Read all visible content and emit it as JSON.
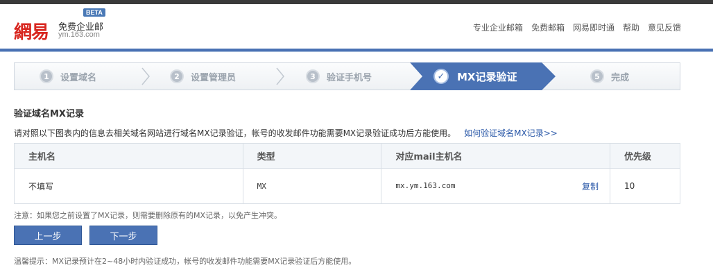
{
  "brand": {
    "logo": "網易",
    "title": "免费企业邮",
    "domain": "ym.163.com",
    "badge": "BETA"
  },
  "nav": [
    "专业企业邮箱",
    "免费邮箱",
    "网易即时通",
    "帮助",
    "意见反馈"
  ],
  "steps": [
    {
      "num": "1",
      "label": "设置域名"
    },
    {
      "num": "2",
      "label": "设置管理员"
    },
    {
      "num": "3",
      "label": "验证手机号"
    },
    {
      "num": "✓",
      "label": "MX记录验证",
      "active": true
    },
    {
      "num": "5",
      "label": "完成"
    }
  ],
  "section": {
    "title": "验证域名MX记录",
    "description": "请对照以下图表内的信息去相关域名网站进行域名MX记录验证，帐号的收发邮件功能需要MX记录验证成功后方能使用。",
    "help_link": "如何验证域名MX记录>>"
  },
  "table": {
    "headers": [
      "主机名",
      "类型",
      "对应mail主机名",
      "优先级"
    ],
    "row": {
      "host": "不填写",
      "type": "MX",
      "mail_host": "mx.ym.163.com",
      "copy_label": "复制",
      "priority": "10"
    }
  },
  "note": "注意：如果您之前设置了MX记录，则需要删除原有的MX记录，以免产生冲突。",
  "buttons": {
    "prev": "上一步",
    "next": "下一步"
  },
  "tip": "温馨提示：MX记录预计在2~48小时内验证成功，帐号的收发邮件功能需要MX记录验证后方能使用。",
  "colors": {
    "accent": "#4a72b4",
    "logo_red": "#d8261f",
    "link": "#2a58a8"
  }
}
